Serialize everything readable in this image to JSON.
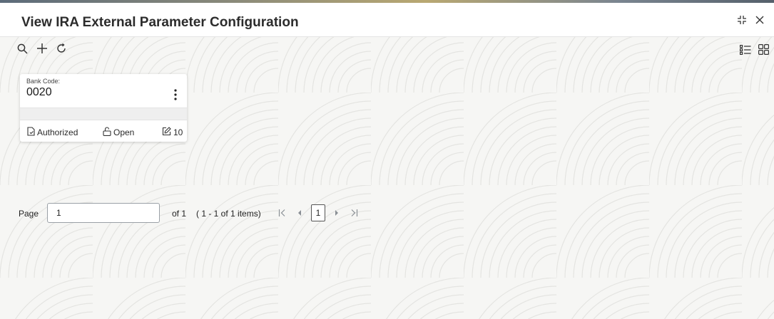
{
  "window": {
    "title": "View IRA External Parameter Configuration",
    "icons": [
      "minimize-icon",
      "close-icon"
    ]
  },
  "toolbar": {
    "icons": [
      "search-icon",
      "add-icon",
      "refresh-icon"
    ]
  },
  "view_toggle": {
    "icons": [
      "list-view-icon",
      "tile-view-icon"
    ]
  },
  "card": {
    "field_label": "Bank Code:",
    "field_value": "0020",
    "status_authorization": "Authorized",
    "status_record": "Open",
    "modification_count": "10",
    "icons": [
      "kebab-menu-icon",
      "authorized-icon",
      "unlock-icon",
      "edit-icon"
    ]
  },
  "pagination": {
    "page_label": "Page",
    "page_value": "1",
    "of_text": "of 1",
    "items_text": "( 1 - 1 of 1 items)",
    "current_page": "1",
    "icons": [
      "first-page-icon",
      "previous-page-icon",
      "next-page-icon",
      "last-page-icon"
    ]
  },
  "colors": {
    "background": "#f6f6f4",
    "header": "#ffffff",
    "text": "#1f1f1f",
    "pattern": "#e6e6e3"
  }
}
